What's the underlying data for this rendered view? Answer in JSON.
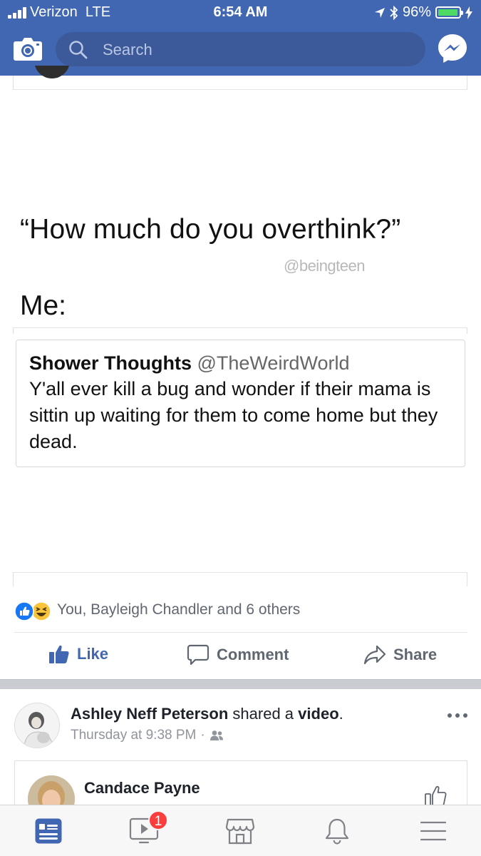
{
  "status_bar": {
    "carrier": "Verizon",
    "network": "LTE",
    "time": "6:54 AM",
    "battery_percent": "96%",
    "battery_level": 0.96
  },
  "header": {
    "search_placeholder": "Search",
    "icons": [
      "camera-icon",
      "search-icon",
      "messenger-icon"
    ],
    "accent_color": "#4267b2"
  },
  "post": {
    "meme": {
      "question": "“How much do you overthink?”",
      "watermark": "@beingteen",
      "me_label": "Me:",
      "tweet": {
        "name": "Shower Thoughts",
        "handle": "@TheWeirdWorld",
        "text": "Y'all ever kill a bug and wonder if their mama is sittin up waiting for them to come home but they dead."
      }
    },
    "reactions_text": "You, Bayleigh Chandler and 6 others",
    "actions": {
      "like": "Like",
      "comment": "Comment",
      "share": "Share"
    }
  },
  "next_post": {
    "author": "Ashley Neff Peterson",
    "shared_text": "shared a",
    "object": "video",
    "period": ".",
    "timestamp": "Thursday at 9:38 PM",
    "separator": "·",
    "shared_card": {
      "name": "Candace Payne"
    }
  },
  "tabbar": {
    "tabs": [
      "news-feed",
      "watch",
      "marketplace",
      "notifications",
      "menu"
    ],
    "watch_badge": "1",
    "active_color": "#4267b2",
    "inactive_color": "#7f8186"
  }
}
